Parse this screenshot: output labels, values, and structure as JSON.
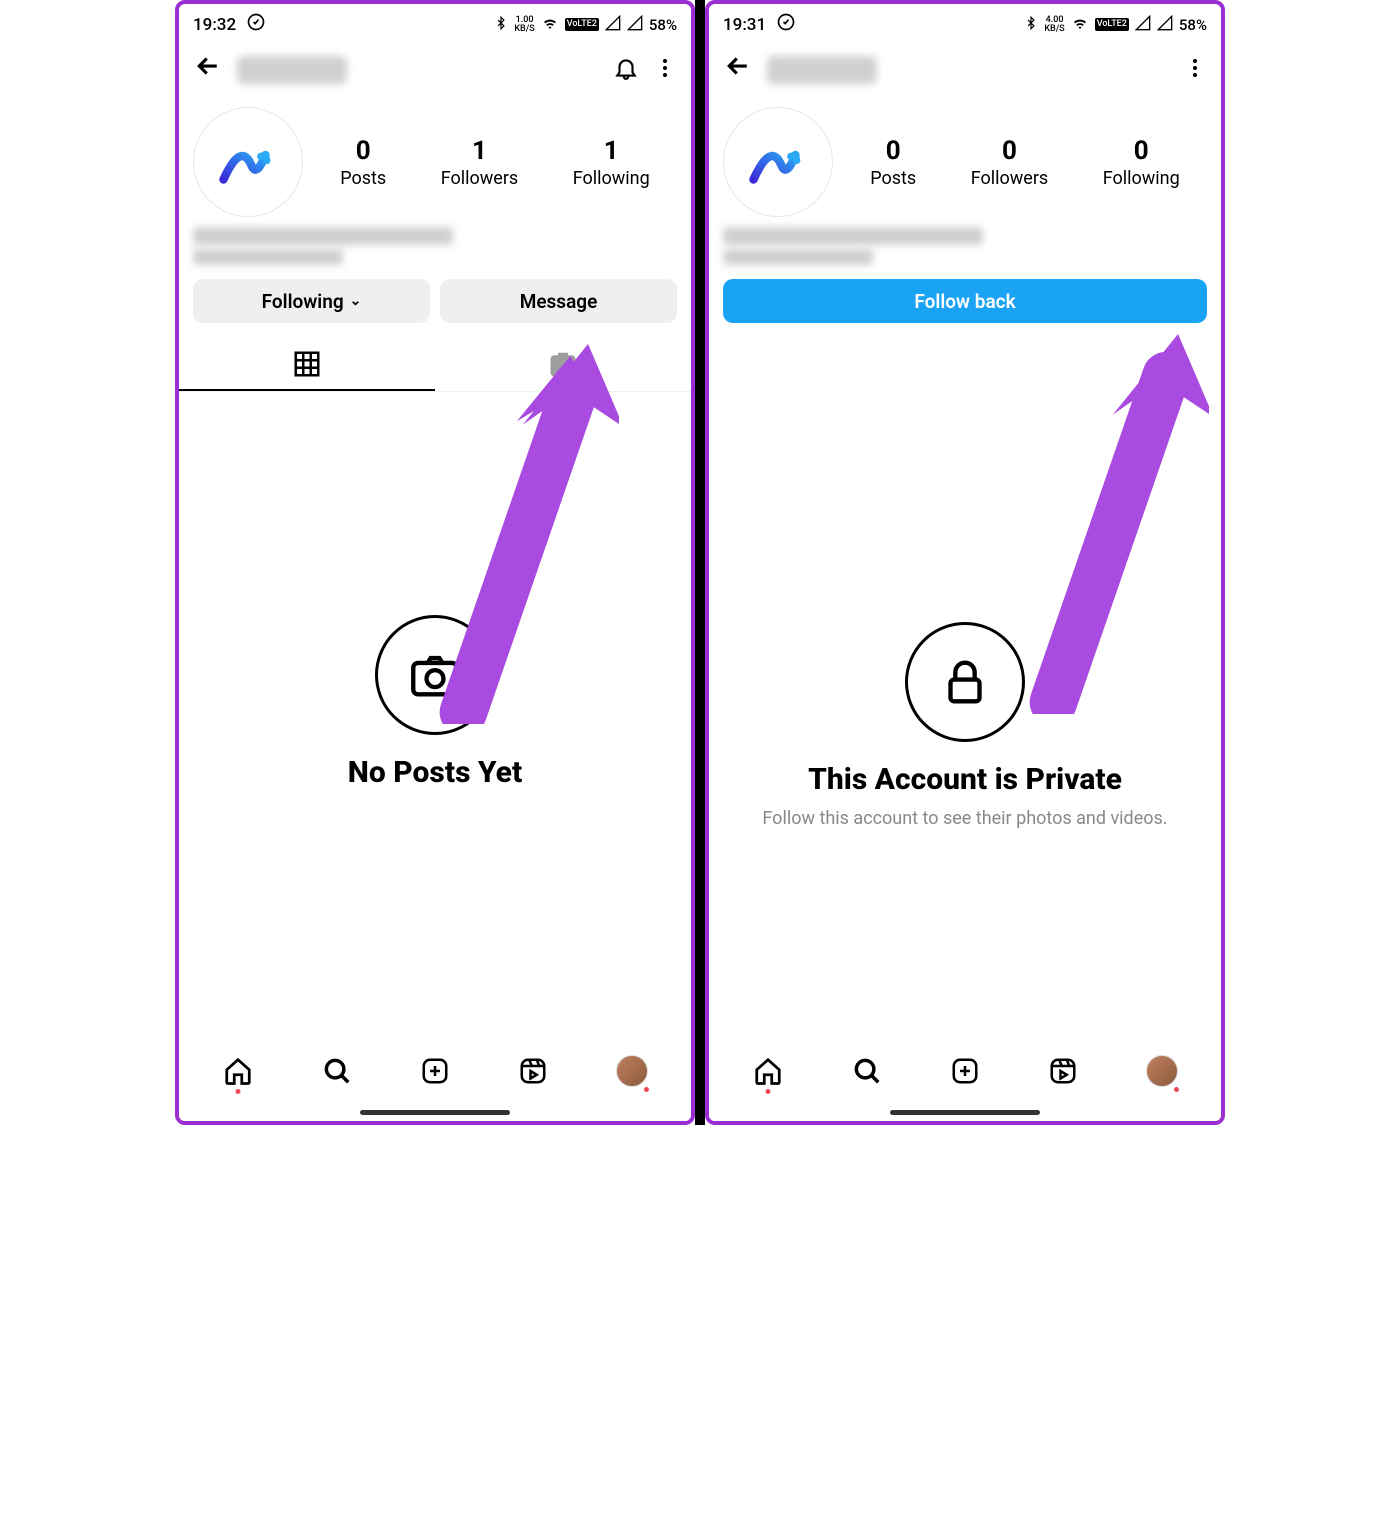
{
  "left": {
    "status": {
      "time": "19:32",
      "kbps": "1.00",
      "kbps_label": "KB/S",
      "lte": "VoLTE2",
      "battery": "58%"
    },
    "stats": {
      "posts": {
        "num": "0",
        "label": "Posts"
      },
      "followers": {
        "num": "1",
        "label": "Followers"
      },
      "following": {
        "num": "1",
        "label": "Following"
      }
    },
    "buttons": {
      "following": "Following",
      "message": "Message"
    },
    "empty": {
      "title": "No Posts Yet"
    }
  },
  "right": {
    "status": {
      "time": "19:31",
      "kbps": "4.00",
      "kbps_label": "KB/S",
      "lte": "VoLTE2",
      "battery": "58%"
    },
    "stats": {
      "posts": {
        "num": "0",
        "label": "Posts"
      },
      "followers": {
        "num": "0",
        "label": "Followers"
      },
      "following": {
        "num": "0",
        "label": "Following"
      }
    },
    "buttons": {
      "follow_back": "Follow back"
    },
    "empty": {
      "title": "This Account is Private",
      "sub": "Follow this account to see their photos and videos."
    }
  }
}
